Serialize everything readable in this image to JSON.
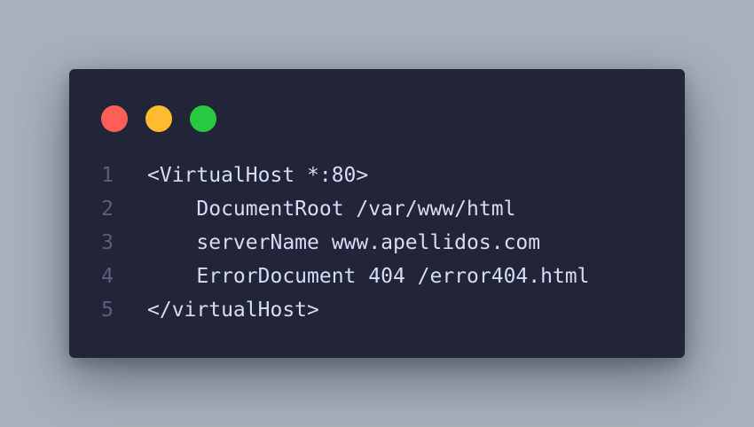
{
  "window": {
    "controls": [
      {
        "name": "close",
        "color": "#ff5f57"
      },
      {
        "name": "minimize",
        "color": "#febc2e"
      },
      {
        "name": "maximize",
        "color": "#28c840"
      }
    ]
  },
  "code": {
    "lines": [
      {
        "number": "1",
        "text": "<VirtualHost *:80>"
      },
      {
        "number": "2",
        "text": "    DocumentRoot /var/www/html"
      },
      {
        "number": "3",
        "text": "    serverName www.apellidos.com"
      },
      {
        "number": "4",
        "text": "    ErrorDocument 404 /error404.html"
      },
      {
        "number": "5",
        "text": "</virtualHost>"
      }
    ]
  }
}
